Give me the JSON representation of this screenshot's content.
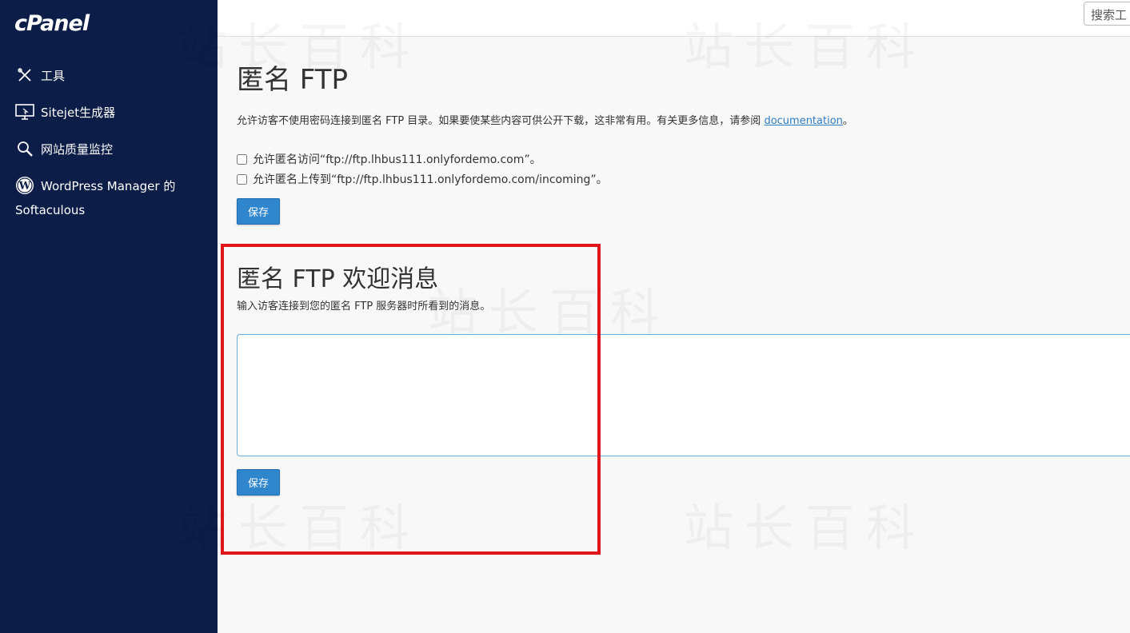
{
  "sidebar": {
    "logo": "cPanel",
    "items": [
      {
        "label": "工具",
        "icon": "tools-icon"
      },
      {
        "label": "Sitejet生成器",
        "icon": "monitor-icon"
      },
      {
        "label": "网站质量监控",
        "icon": "magnifier-icon"
      },
      {
        "label_line1": "WordPress Manager 的",
        "label_line2": "Softaculous",
        "icon": "wordpress-icon"
      }
    ]
  },
  "topbar": {
    "search_text": "搜索工"
  },
  "watermark": "站长百科",
  "main": {
    "title": "匿名 FTP",
    "description": "允许访客不使用密码连接到匿名 FTP 目录。如果要使某些内容可供公开下载，这非常有用。有关更多信息，请参阅 ",
    "doc_link": "documentation",
    "description_end": "。",
    "checkboxes": [
      {
        "label": "允许匿名访问“ftp://ftp.lhbus111.onlyfordemo.com”。",
        "checked": false
      },
      {
        "label": "允许匿名上传到“ftp://ftp.lhbus111.onlyfordemo.com/incoming”。",
        "checked": false
      }
    ],
    "save_label": "保存"
  },
  "welcome": {
    "title": "匿名 FTP 欢迎消息",
    "subtitle": "输入访客连接到您的匿名 FTP 服务器时所看到的消息。",
    "message": "",
    "save_label": "保存"
  },
  "colors": {
    "sidebar_bg": "#0c1d47",
    "button_bg": "#2f86cd",
    "highlight": "#e0141b",
    "link": "#2f7bbf"
  }
}
